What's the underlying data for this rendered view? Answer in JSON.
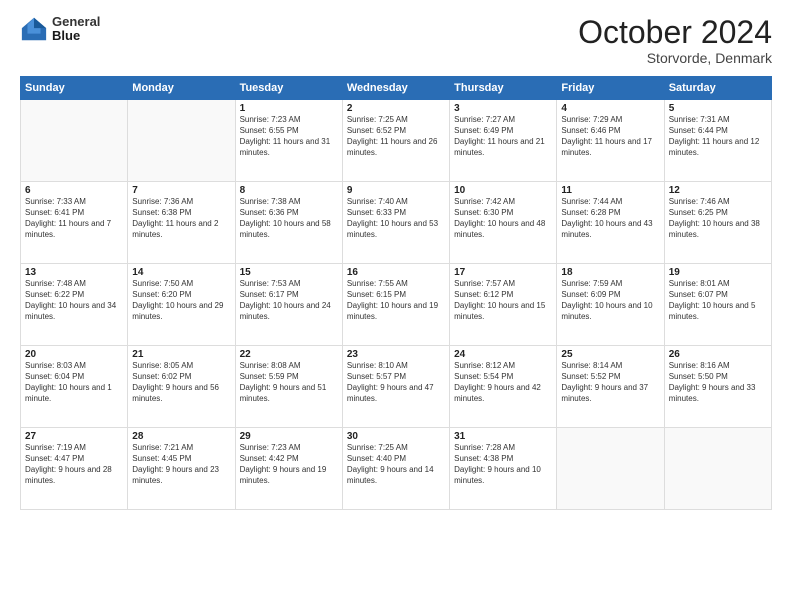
{
  "header": {
    "logo_line1": "General",
    "logo_line2": "Blue",
    "month": "October 2024",
    "location": "Storvorde, Denmark"
  },
  "days_of_week": [
    "Sunday",
    "Monday",
    "Tuesday",
    "Wednesday",
    "Thursday",
    "Friday",
    "Saturday"
  ],
  "weeks": [
    [
      {
        "num": "",
        "info": ""
      },
      {
        "num": "",
        "info": ""
      },
      {
        "num": "1",
        "info": "Sunrise: 7:23 AM\nSunset: 6:55 PM\nDaylight: 11 hours and 31 minutes."
      },
      {
        "num": "2",
        "info": "Sunrise: 7:25 AM\nSunset: 6:52 PM\nDaylight: 11 hours and 26 minutes."
      },
      {
        "num": "3",
        "info": "Sunrise: 7:27 AM\nSunset: 6:49 PM\nDaylight: 11 hours and 21 minutes."
      },
      {
        "num": "4",
        "info": "Sunrise: 7:29 AM\nSunset: 6:46 PM\nDaylight: 11 hours and 17 minutes."
      },
      {
        "num": "5",
        "info": "Sunrise: 7:31 AM\nSunset: 6:44 PM\nDaylight: 11 hours and 12 minutes."
      }
    ],
    [
      {
        "num": "6",
        "info": "Sunrise: 7:33 AM\nSunset: 6:41 PM\nDaylight: 11 hours and 7 minutes."
      },
      {
        "num": "7",
        "info": "Sunrise: 7:36 AM\nSunset: 6:38 PM\nDaylight: 11 hours and 2 minutes."
      },
      {
        "num": "8",
        "info": "Sunrise: 7:38 AM\nSunset: 6:36 PM\nDaylight: 10 hours and 58 minutes."
      },
      {
        "num": "9",
        "info": "Sunrise: 7:40 AM\nSunset: 6:33 PM\nDaylight: 10 hours and 53 minutes."
      },
      {
        "num": "10",
        "info": "Sunrise: 7:42 AM\nSunset: 6:30 PM\nDaylight: 10 hours and 48 minutes."
      },
      {
        "num": "11",
        "info": "Sunrise: 7:44 AM\nSunset: 6:28 PM\nDaylight: 10 hours and 43 minutes."
      },
      {
        "num": "12",
        "info": "Sunrise: 7:46 AM\nSunset: 6:25 PM\nDaylight: 10 hours and 38 minutes."
      }
    ],
    [
      {
        "num": "13",
        "info": "Sunrise: 7:48 AM\nSunset: 6:22 PM\nDaylight: 10 hours and 34 minutes."
      },
      {
        "num": "14",
        "info": "Sunrise: 7:50 AM\nSunset: 6:20 PM\nDaylight: 10 hours and 29 minutes."
      },
      {
        "num": "15",
        "info": "Sunrise: 7:53 AM\nSunset: 6:17 PM\nDaylight: 10 hours and 24 minutes."
      },
      {
        "num": "16",
        "info": "Sunrise: 7:55 AM\nSunset: 6:15 PM\nDaylight: 10 hours and 19 minutes."
      },
      {
        "num": "17",
        "info": "Sunrise: 7:57 AM\nSunset: 6:12 PM\nDaylight: 10 hours and 15 minutes."
      },
      {
        "num": "18",
        "info": "Sunrise: 7:59 AM\nSunset: 6:09 PM\nDaylight: 10 hours and 10 minutes."
      },
      {
        "num": "19",
        "info": "Sunrise: 8:01 AM\nSunset: 6:07 PM\nDaylight: 10 hours and 5 minutes."
      }
    ],
    [
      {
        "num": "20",
        "info": "Sunrise: 8:03 AM\nSunset: 6:04 PM\nDaylight: 10 hours and 1 minute."
      },
      {
        "num": "21",
        "info": "Sunrise: 8:05 AM\nSunset: 6:02 PM\nDaylight: 9 hours and 56 minutes."
      },
      {
        "num": "22",
        "info": "Sunrise: 8:08 AM\nSunset: 5:59 PM\nDaylight: 9 hours and 51 minutes."
      },
      {
        "num": "23",
        "info": "Sunrise: 8:10 AM\nSunset: 5:57 PM\nDaylight: 9 hours and 47 minutes."
      },
      {
        "num": "24",
        "info": "Sunrise: 8:12 AM\nSunset: 5:54 PM\nDaylight: 9 hours and 42 minutes."
      },
      {
        "num": "25",
        "info": "Sunrise: 8:14 AM\nSunset: 5:52 PM\nDaylight: 9 hours and 37 minutes."
      },
      {
        "num": "26",
        "info": "Sunrise: 8:16 AM\nSunset: 5:50 PM\nDaylight: 9 hours and 33 minutes."
      }
    ],
    [
      {
        "num": "27",
        "info": "Sunrise: 7:19 AM\nSunset: 4:47 PM\nDaylight: 9 hours and 28 minutes."
      },
      {
        "num": "28",
        "info": "Sunrise: 7:21 AM\nSunset: 4:45 PM\nDaylight: 9 hours and 23 minutes."
      },
      {
        "num": "29",
        "info": "Sunrise: 7:23 AM\nSunset: 4:42 PM\nDaylight: 9 hours and 19 minutes."
      },
      {
        "num": "30",
        "info": "Sunrise: 7:25 AM\nSunset: 4:40 PM\nDaylight: 9 hours and 14 minutes."
      },
      {
        "num": "31",
        "info": "Sunrise: 7:28 AM\nSunset: 4:38 PM\nDaylight: 9 hours and 10 minutes."
      },
      {
        "num": "",
        "info": ""
      },
      {
        "num": "",
        "info": ""
      }
    ]
  ]
}
